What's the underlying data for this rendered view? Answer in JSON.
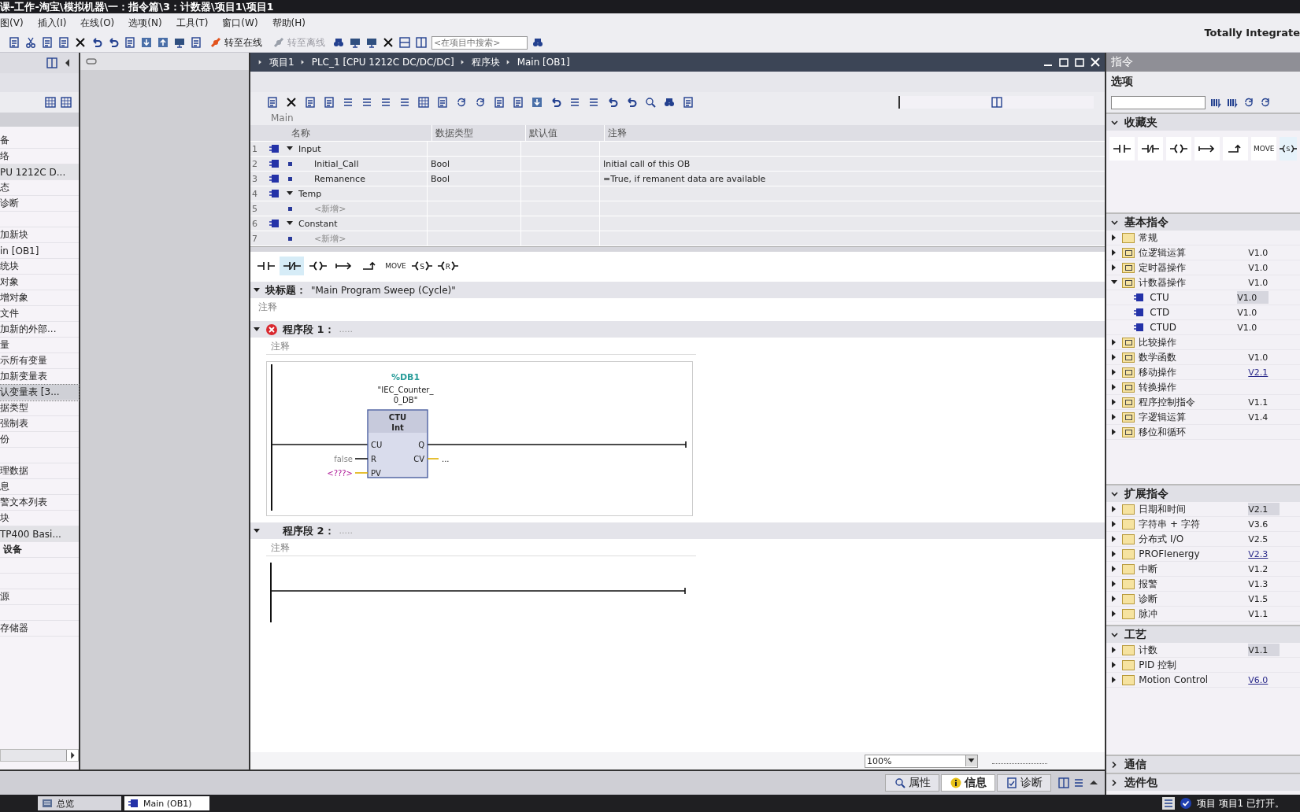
{
  "window": {
    "title": "课-工作-淘宝\\模拟机器\\一：指令篇\\3：计数器\\项目1\\项目1"
  },
  "menu": [
    "图(V)",
    "插入(I)",
    "在线(O)",
    "选项(N)",
    "工具(T)",
    "窗口(W)",
    "帮助(H)"
  ],
  "toolbar": {
    "go_online": {
      "label": "转至在线",
      "disabled": false
    },
    "go_offline": {
      "label": "转至离线",
      "disabled": true
    },
    "search": {
      "placeholder": "<在项目中搜索>"
    }
  },
  "product_name": "Totally Integrate",
  "project_tree": {
    "items": [
      {
        "label": "备",
        "kind": "item",
        "selected": false
      },
      {
        "label": "络",
        "kind": "item",
        "selected": false
      },
      {
        "label": "PU 1212C D...",
        "kind": "group",
        "selected": false
      },
      {
        "label": "态",
        "kind": "item",
        "selected": false
      },
      {
        "label": "诊断",
        "kind": "item",
        "selected": false
      },
      {
        "kind": "blank"
      },
      {
        "label": "加新块",
        "kind": "item",
        "selected": false
      },
      {
        "label": "in [OB1]",
        "kind": "item",
        "selected": false
      },
      {
        "label": "统块",
        "kind": "item",
        "selected": false
      },
      {
        "label": "对象",
        "kind": "item",
        "selected": false
      },
      {
        "label": "增对象",
        "kind": "item",
        "selected": false
      },
      {
        "label": "文件",
        "kind": "item",
        "selected": false
      },
      {
        "label": "加新的外部...",
        "kind": "item",
        "selected": false
      },
      {
        "label": "量",
        "kind": "item",
        "selected": false
      },
      {
        "label": "示所有变量",
        "kind": "item",
        "selected": false
      },
      {
        "label": "加新变量表",
        "kind": "item",
        "selected": false
      },
      {
        "label": "认变量表 [3...",
        "kind": "item",
        "selected": true
      },
      {
        "label": "据类型",
        "kind": "item",
        "selected": false
      },
      {
        "label": "强制表",
        "kind": "item",
        "selected": false
      },
      {
        "label": "份",
        "kind": "item",
        "selected": false
      },
      {
        "kind": "blank"
      },
      {
        "label": "理数据",
        "kind": "item",
        "selected": false
      },
      {
        "label": "息",
        "kind": "item",
        "selected": false
      },
      {
        "label": "警文本列表",
        "kind": "item",
        "selected": false
      },
      {
        "label": "块",
        "kind": "item",
        "selected": false
      },
      {
        "label": "TP400 Basi...",
        "kind": "group",
        "selected": false
      },
      {
        "label": "设备",
        "kind": "heading",
        "selected": false
      },
      {
        "kind": "blank"
      },
      {
        "kind": "blank"
      },
      {
        "label": "源",
        "kind": "item",
        "selected": false
      },
      {
        "kind": "blank"
      },
      {
        "label": "存储器",
        "kind": "item",
        "selected": false
      }
    ]
  },
  "editor": {
    "breadcrumb": [
      "项目1",
      "PLC_1 [CPU 1212C DC/DC/DC]",
      "程序块",
      "Main [OB1]"
    ],
    "block_name": "Main",
    "interface": {
      "columns": [
        "名称",
        "数据类型",
        "默认值",
        "注释"
      ],
      "rows": [
        {
          "no": "1",
          "kind": "section",
          "name": "Input",
          "expanded": true
        },
        {
          "no": "2",
          "kind": "variable",
          "name": "Initial_Call",
          "type": "Bool",
          "comment": "Initial call of this OB"
        },
        {
          "no": "3",
          "kind": "variable",
          "name": "Remanence",
          "type": "Bool",
          "comment": "=True, if remanent data are available"
        },
        {
          "no": "4",
          "kind": "section",
          "name": "Temp",
          "expanded": true
        },
        {
          "no": "5",
          "kind": "new",
          "name": "<新增>"
        },
        {
          "no": "6",
          "kind": "section",
          "name": "Constant",
          "expanded": true
        },
        {
          "no": "7",
          "kind": "new",
          "name": "<新增>"
        }
      ]
    },
    "instruction_bar": [
      {
        "kind": "contact",
        "selected": false
      },
      {
        "kind": "ncontact",
        "selected": true
      },
      {
        "kind": "coil",
        "selected": false
      },
      {
        "kind": "branch_open",
        "selected": false
      },
      {
        "kind": "branch_close",
        "selected": false
      },
      {
        "kind": "box",
        "label": "MOVE",
        "selected": false
      },
      {
        "kind": "letter_coil",
        "label": "S",
        "selected": false
      },
      {
        "kind": "letter_coil",
        "label": "R",
        "selected": false
      }
    ],
    "block_title": {
      "label": "块标题：",
      "value": "\"Main Program Sweep (Cycle)\"",
      "comment": "注释",
      "expanded": true
    },
    "networks": [
      {
        "title": "程序段 1：",
        "dots": ".....",
        "error": true,
        "expanded": true,
        "comment": "注释",
        "instance": {
          "address": "%DB1",
          "name_lines": [
            "\"IEC_Counter_",
            "0_DB\""
          ],
          "type": "CTU",
          "data_type": "Int",
          "inputs": [
            {
              "pin": "CU"
            },
            {
              "pin": "R",
              "value": "false"
            },
            {
              "pin": "PV",
              "value": "<???>"
            }
          ],
          "outputs": [
            {
              "pin": "Q"
            },
            {
              "pin": "CV",
              "value": "..."
            }
          ]
        }
      },
      {
        "title": "程序段 2：",
        "dots": ".....",
        "error": false,
        "expanded": true,
        "comment": "注释"
      }
    ],
    "zoom": {
      "value": "100%"
    }
  },
  "instructions_panel": {
    "title": "指令",
    "options_label": "选项",
    "favorites": {
      "title": "收藏夹",
      "expanded": true,
      "items": [
        {
          "kind": "contact"
        },
        {
          "kind": "ncontact"
        },
        {
          "kind": "coil"
        },
        {
          "kind": "branch_open"
        },
        {
          "kind": "branch_close"
        },
        {
          "kind": "box",
          "label": "MOVE"
        },
        {
          "kind": "letter_coil",
          "label": "S"
        }
      ]
    },
    "sections": [
      {
        "title": "基本指令",
        "expanded": true,
        "items": [
          {
            "label": "常规",
            "expanded": false,
            "selected": false
          },
          {
            "label": "位逻辑运算",
            "version": "V1.0",
            "link": false,
            "expanded": false,
            "selected": false
          },
          {
            "label": "定时器操作",
            "version": "V1.0",
            "link": false,
            "expanded": false,
            "selected": false
          },
          {
            "label": "计数器操作",
            "version": "V1.0",
            "link": false,
            "expanded": true,
            "selected": false,
            "children": [
              {
                "label": "CTU",
                "version": "V1.0",
                "selected": true
              },
              {
                "label": "CTD",
                "version": "V1.0",
                "selected": false
              },
              {
                "label": "CTUD",
                "version": "V1.0",
                "selected": false
              }
            ]
          },
          {
            "label": "比较操作",
            "expanded": false,
            "selected": false
          },
          {
            "label": "数学函数",
            "version": "V1.0",
            "link": false,
            "expanded": false,
            "selected": false
          },
          {
            "label": "移动操作",
            "version": "V2.1",
            "link": true,
            "expanded": false,
            "selected": false
          },
          {
            "label": "转换操作",
            "expanded": false,
            "selected": false
          },
          {
            "label": "程序控制指令",
            "version": "V1.1",
            "link": false,
            "expanded": false,
            "selected": false
          },
          {
            "label": "字逻辑运算",
            "version": "V1.4",
            "link": false,
            "expanded": false,
            "selected": false
          },
          {
            "label": "移位和循环",
            "expanded": false,
            "selected": false
          }
        ]
      },
      {
        "title": "扩展指令",
        "expanded": true,
        "items": [
          {
            "label": "日期和时间",
            "version": "V2.1",
            "link": false,
            "selected": true,
            "expanded": false
          },
          {
            "label": "字符串 + 字符",
            "version": "V3.6",
            "link": false,
            "selected": false,
            "expanded": false
          },
          {
            "label": "分布式 I/O",
            "version": "V2.5",
            "link": false,
            "selected": false,
            "expanded": false
          },
          {
            "label": "PROFIenergy",
            "version": "V2.3",
            "link": true,
            "selected": false,
            "expanded": false
          },
          {
            "label": "中断",
            "version": "V1.2",
            "link": false,
            "selected": false,
            "expanded": false
          },
          {
            "label": "报警",
            "version": "V1.3",
            "link": false,
            "selected": false,
            "expanded": false
          },
          {
            "label": "诊断",
            "version": "V1.5",
            "link": false,
            "selected": false,
            "expanded": false
          },
          {
            "label": "脉冲",
            "version": "V1.1",
            "link": false,
            "selected": false,
            "expanded": false
          }
        ]
      },
      {
        "title": "工艺",
        "expanded": true,
        "items": [
          {
            "label": "计数",
            "version": "V1.1",
            "link": false,
            "selected": true,
            "expanded": false
          },
          {
            "label": "PID 控制",
            "selected": false,
            "expanded": false
          },
          {
            "label": "Motion Control",
            "version": "V6.0",
            "link": true,
            "selected": false,
            "expanded": false
          }
        ]
      },
      {
        "title": "通信",
        "expanded": false
      },
      {
        "title": "选件包",
        "expanded": false
      }
    ]
  },
  "bottom_tabs": [
    {
      "label": "属性",
      "kind": "properties",
      "selected": false
    },
    {
      "label": "信息",
      "kind": "info",
      "selected": true
    },
    {
      "label": "诊断",
      "kind": "diagnostics",
      "selected": false
    }
  ],
  "taskbar": {
    "portal": "总览",
    "open_editors": [
      {
        "label": "Main (OB1)",
        "selected": true
      }
    ],
    "status": "项目 项目1 已打开。"
  }
}
